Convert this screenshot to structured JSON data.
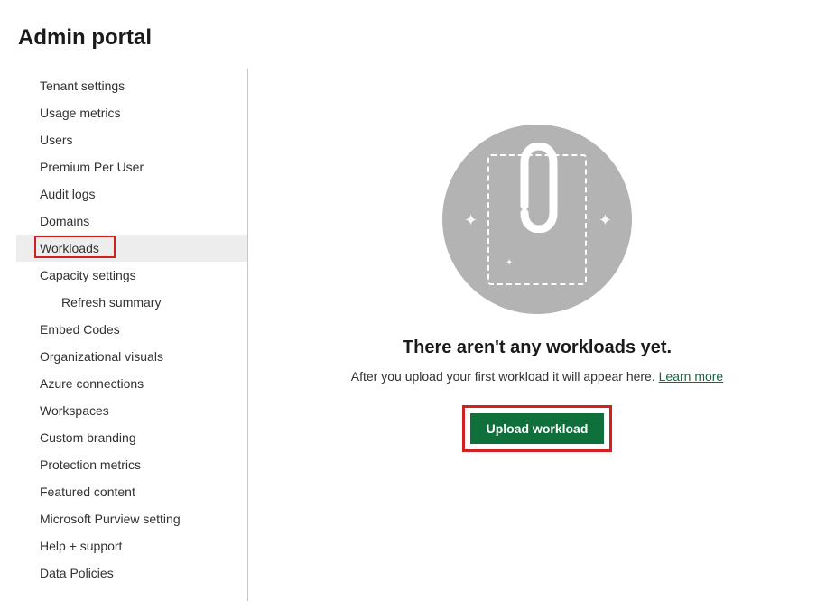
{
  "page_title": "Admin portal",
  "sidebar": {
    "items": [
      {
        "label": "Tenant settings",
        "selected": false,
        "sub": false
      },
      {
        "label": "Usage metrics",
        "selected": false,
        "sub": false
      },
      {
        "label": "Users",
        "selected": false,
        "sub": false
      },
      {
        "label": "Premium Per User",
        "selected": false,
        "sub": false
      },
      {
        "label": "Audit logs",
        "selected": false,
        "sub": false
      },
      {
        "label": "Domains",
        "selected": false,
        "sub": false
      },
      {
        "label": "Workloads",
        "selected": true,
        "sub": false,
        "highlighted": true
      },
      {
        "label": "Capacity settings",
        "selected": false,
        "sub": false
      },
      {
        "label": "Refresh summary",
        "selected": false,
        "sub": true
      },
      {
        "label": "Embed Codes",
        "selected": false,
        "sub": false
      },
      {
        "label": "Organizational visuals",
        "selected": false,
        "sub": false
      },
      {
        "label": "Azure connections",
        "selected": false,
        "sub": false
      },
      {
        "label": "Workspaces",
        "selected": false,
        "sub": false
      },
      {
        "label": "Custom branding",
        "selected": false,
        "sub": false
      },
      {
        "label": "Protection metrics",
        "selected": false,
        "sub": false
      },
      {
        "label": "Featured content",
        "selected": false,
        "sub": false
      },
      {
        "label": "Microsoft Purview setting",
        "selected": false,
        "sub": false
      },
      {
        "label": "Help + support",
        "selected": false,
        "sub": false
      },
      {
        "label": "Data Policies",
        "selected": false,
        "sub": false
      }
    ]
  },
  "main": {
    "empty_heading": "There aren't any workloads yet.",
    "empty_sub_text": "After you upload your first workload it will appear here. ",
    "learn_more": "Learn more",
    "upload_button": "Upload workload"
  }
}
